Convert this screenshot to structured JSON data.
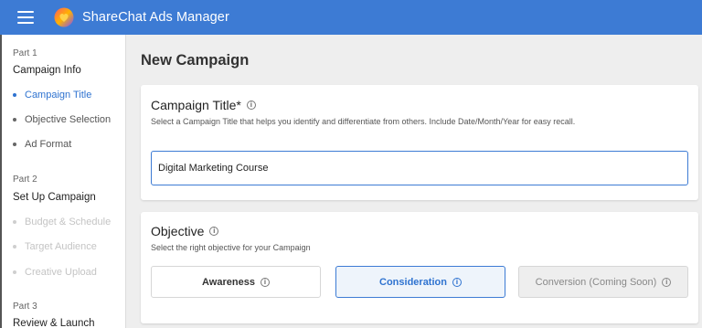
{
  "header": {
    "app_title": "ShareChat Ads Manager",
    "menu_icon": "hamburger-menu-icon",
    "logo_icon": "sharechat-logo",
    "bar_color": "#3d7bd4"
  },
  "sidebar": {
    "parts": [
      {
        "part_label": "Part 1",
        "title": "Campaign Info",
        "steps": [
          {
            "label": "Campaign Title",
            "state": "active"
          },
          {
            "label": "Objective Selection",
            "state": "normal"
          },
          {
            "label": "Ad Format",
            "state": "normal"
          }
        ]
      },
      {
        "part_label": "Part 2",
        "title": "Set Up Campaign",
        "steps": [
          {
            "label": "Budget & Schedule",
            "state": "disabled"
          },
          {
            "label": "Target Audience",
            "state": "disabled"
          },
          {
            "label": "Creative Upload",
            "state": "disabled"
          }
        ]
      },
      {
        "part_label": "Part 3",
        "title": "Review & Launch"
      }
    ],
    "active_color": "#2f73d0"
  },
  "main": {
    "page_title": "New Campaign",
    "campaign_title_card": {
      "title": "Campaign Title*",
      "subtitle": "Select a Campaign Title that helps you identify and differentiate from others. Include Date/Month/Year for easy recall.",
      "input_value": "Digital Marketing Course"
    },
    "objective_card": {
      "title": "Objective",
      "subtitle": "Select the right objective for your Campaign",
      "options": [
        {
          "label": "Awareness",
          "state": "default"
        },
        {
          "label": "Consideration",
          "state": "selected"
        },
        {
          "label": "Conversion (Coming Soon)",
          "state": "disabled"
        }
      ]
    }
  }
}
